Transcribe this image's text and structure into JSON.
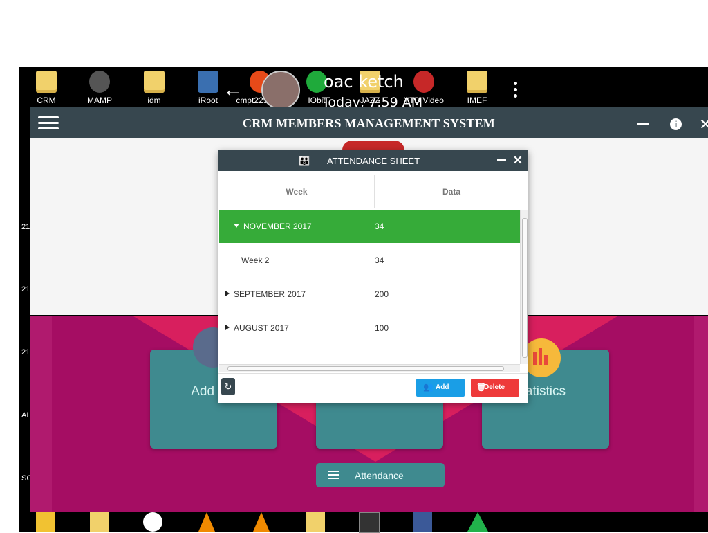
{
  "desktop_icons": [
    {
      "label": "CRM",
      "kind": "folder"
    },
    {
      "label": "MAMP",
      "kind": "shortcut"
    },
    {
      "label": "idm",
      "kind": "folder"
    },
    {
      "label": "iRoot",
      "kind": "shortcut"
    },
    {
      "label": "cmpt225_4...",
      "kind": "shortcut"
    },
    {
      "label": "IObit",
      "kind": "shortcut"
    },
    {
      "label": "JAZZ",
      "kind": "folder"
    },
    {
      "label": "YTD Video",
      "kind": "shortcut"
    },
    {
      "label": "IMEF",
      "kind": "folder"
    }
  ],
  "overlay": {
    "line1": "oac  ketch",
    "line2": "Today, 7:59 AM"
  },
  "app": {
    "title": "CRM MEMBERS MANAGEMENT SYSTEM",
    "minimize_icon": "minus-icon",
    "info_icon": "info-icon",
    "close_icon": "close-icon"
  },
  "side_labels": [
    "21",
    "21",
    "21",
    "AI",
    "SC"
  ],
  "cards": [
    {
      "label": "Add Me"
    },
    {
      "label": ""
    },
    {
      "label": "atistics"
    }
  ],
  "attendance_button": {
    "label": "Attendance",
    "icon": "list-icon"
  },
  "dialog": {
    "title": "ATTENDANCE SHEET",
    "icon": "family-icon",
    "columns": [
      "Week",
      "Data"
    ],
    "rows": [
      {
        "week": "NOVEMBER 2017",
        "data": "34",
        "expanded": true,
        "selected": true,
        "level": 0
      },
      {
        "week": "Week 2",
        "data": "34",
        "expanded": false,
        "selected": false,
        "level": 1
      },
      {
        "week": "SEPTEMBER 2017",
        "data": "200",
        "expanded": false,
        "selected": false,
        "level": 0
      },
      {
        "week": "AUGUST 2017",
        "data": "100",
        "expanded": false,
        "selected": false,
        "level": 0
      }
    ],
    "buttons": {
      "add": "Add",
      "delete": "Delete"
    }
  },
  "colors": {
    "header": "#37474f",
    "selected_row": "#36ab39",
    "magenta": "#a50d63",
    "card": "#3f8a8f",
    "add_button": "#1a9ee6",
    "delete_button": "#ee3a3a"
  }
}
